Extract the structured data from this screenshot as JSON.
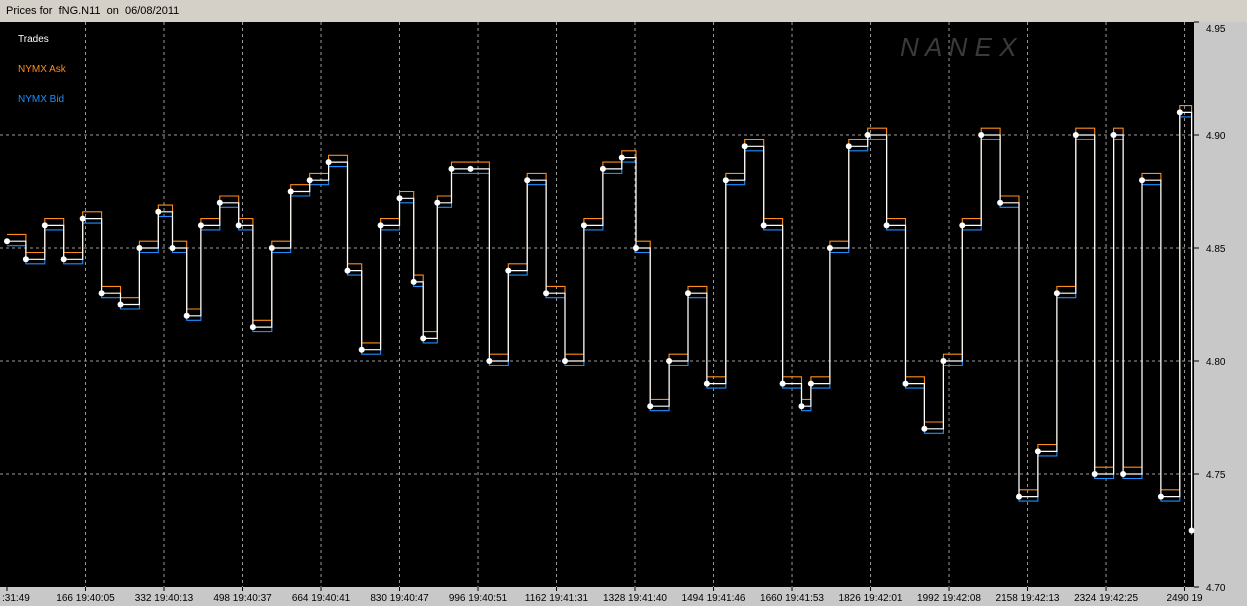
{
  "window": {
    "title": "Prices for  fNG.N11  on  06/08/2011"
  },
  "watermark": "N A N E X",
  "legend": [
    {
      "label": "Trades",
      "color": "#ffffff"
    },
    {
      "label": "NYMX Ask",
      "color": "#ff8c1a"
    },
    {
      "label": "NYMX Bid",
      "color": "#1e8fff"
    }
  ],
  "chart_data": {
    "type": "line",
    "title": "Prices for  fNG.N11  on  06/08/2011",
    "ylim": [
      4.7,
      4.95
    ],
    "yticks": [
      "4.70",
      "4.75",
      "4.80",
      "4.85",
      "4.90",
      "4.95"
    ],
    "grid": true,
    "legend_position": "top-left",
    "xlim": [
      0,
      2510
    ],
    "xticks": [
      {
        "pos": 0,
        "label": ":31:49"
      },
      {
        "pos": 166,
        "label": "166 19:40:05"
      },
      {
        "pos": 332,
        "label": "332 19:40:13"
      },
      {
        "pos": 498,
        "label": "498 19:40:37"
      },
      {
        "pos": 664,
        "label": "664 19:40:41"
      },
      {
        "pos": 830,
        "label": "830 19:40:47"
      },
      {
        "pos": 996,
        "label": "996 19:40:51"
      },
      {
        "pos": 1162,
        "label": "1162 19:41:31"
      },
      {
        "pos": 1328,
        "label": "1328 19:41:40"
      },
      {
        "pos": 1494,
        "label": "1494 19:41:46"
      },
      {
        "pos": 1660,
        "label": "1660 19:41:53"
      },
      {
        "pos": 1826,
        "label": "1826 19:42:01"
      },
      {
        "pos": 1992,
        "label": "1992 19:42:08"
      },
      {
        "pos": 2158,
        "label": "2158 19:42:13"
      },
      {
        "pos": 2324,
        "label": "2324 19:42:25"
      },
      {
        "pos": 2490,
        "label": "2490 19"
      }
    ],
    "series": [
      {
        "name": "Trades",
        "color": "#ffffff",
        "x": [
          0,
          40,
          80,
          120,
          160,
          200,
          240,
          280,
          320,
          350,
          380,
          410,
          450,
          490,
          520,
          560,
          600,
          640,
          680,
          720,
          750,
          790,
          830,
          860,
          880,
          910,
          940,
          980,
          1020,
          1060,
          1100,
          1140,
          1180,
          1220,
          1260,
          1300,
          1330,
          1360,
          1400,
          1440,
          1480,
          1520,
          1560,
          1600,
          1640,
          1680,
          1700,
          1740,
          1780,
          1820,
          1860,
          1900,
          1940,
          1980,
          2020,
          2060,
          2100,
          2140,
          2180,
          2220,
          2260,
          2300,
          2340,
          2360,
          2400,
          2440,
          2480,
          2505
        ],
        "values": [
          4.853,
          4.845,
          4.86,
          4.845,
          4.863,
          4.83,
          4.825,
          4.85,
          4.866,
          4.85,
          4.82,
          4.86,
          4.87,
          4.86,
          4.815,
          4.85,
          4.875,
          4.88,
          4.888,
          4.84,
          4.805,
          4.86,
          4.872,
          4.835,
          4.81,
          4.87,
          4.885,
          4.885,
          4.8,
          4.84,
          4.88,
          4.83,
          4.8,
          4.86,
          4.885,
          4.89,
          4.85,
          4.78,
          4.8,
          4.83,
          4.79,
          4.88,
          4.895,
          4.86,
          4.79,
          4.78,
          4.79,
          4.85,
          4.895,
          4.9,
          4.86,
          4.79,
          4.77,
          4.8,
          4.86,
          4.9,
          4.87,
          4.74,
          4.76,
          4.83,
          4.9,
          4.75,
          4.9,
          4.75,
          4.88,
          4.74,
          4.91,
          4.725
        ]
      },
      {
        "name": "NYMX Ask",
        "color": "#ff8c1a",
        "x": [
          0,
          40,
          80,
          120,
          160,
          200,
          240,
          280,
          320,
          350,
          380,
          410,
          450,
          490,
          520,
          560,
          600,
          640,
          680,
          720,
          750,
          790,
          830,
          860,
          880,
          910,
          940,
          980,
          1020,
          1060,
          1100,
          1140,
          1180,
          1220,
          1260,
          1300,
          1330,
          1360,
          1400,
          1440,
          1480,
          1520,
          1560,
          1600,
          1640,
          1680,
          1700,
          1740,
          1780,
          1820,
          1860,
          1900,
          1940,
          1980,
          2020,
          2060,
          2100,
          2140,
          2180,
          2220,
          2260,
          2300,
          2340,
          2360,
          2400,
          2440,
          2480,
          2505
        ],
        "values": [
          4.856,
          4.848,
          4.863,
          4.848,
          4.866,
          4.833,
          4.828,
          4.853,
          4.869,
          4.853,
          4.823,
          4.863,
          4.873,
          4.863,
          4.818,
          4.853,
          4.878,
          4.883,
          4.891,
          4.843,
          4.808,
          4.863,
          4.875,
          4.838,
          4.813,
          4.873,
          4.888,
          4.888,
          4.803,
          4.843,
          4.883,
          4.833,
          4.803,
          4.863,
          4.888,
          4.893,
          4.853,
          4.783,
          4.803,
          4.833,
          4.793,
          4.883,
          4.898,
          4.863,
          4.793,
          4.783,
          4.793,
          4.853,
          4.898,
          4.903,
          4.863,
          4.793,
          4.773,
          4.803,
          4.863,
          4.903,
          4.873,
          4.743,
          4.763,
          4.833,
          4.903,
          4.753,
          4.903,
          4.753,
          4.883,
          4.743,
          4.913,
          4.728
        ]
      },
      {
        "name": "NYMX Bid",
        "color": "#1e8fff",
        "x": [
          0,
          40,
          80,
          120,
          160,
          200,
          240,
          280,
          320,
          350,
          380,
          410,
          450,
          490,
          520,
          560,
          600,
          640,
          680,
          720,
          750,
          790,
          830,
          860,
          880,
          910,
          940,
          980,
          1020,
          1060,
          1100,
          1140,
          1180,
          1220,
          1260,
          1300,
          1330,
          1360,
          1400,
          1440,
          1480,
          1520,
          1560,
          1600,
          1640,
          1680,
          1700,
          1740,
          1780,
          1820,
          1860,
          1900,
          1940,
          1980,
          2020,
          2060,
          2100,
          2140,
          2180,
          2220,
          2260,
          2300,
          2340,
          2360,
          2400,
          2440,
          2480,
          2505
        ],
        "values": [
          4.851,
          4.843,
          4.858,
          4.843,
          4.861,
          4.828,
          4.823,
          4.848,
          4.864,
          4.848,
          4.818,
          4.858,
          4.868,
          4.858,
          4.813,
          4.848,
          4.873,
          4.878,
          4.886,
          4.838,
          4.803,
          4.858,
          4.87,
          4.833,
          4.808,
          4.868,
          4.883,
          4.883,
          4.798,
          4.838,
          4.878,
          4.828,
          4.798,
          4.858,
          4.883,
          4.888,
          4.848,
          4.778,
          4.798,
          4.828,
          4.788,
          4.878,
          4.893,
          4.858,
          4.788,
          4.778,
          4.788,
          4.848,
          4.893,
          4.898,
          4.858,
          4.788,
          4.768,
          4.798,
          4.858,
          4.898,
          4.868,
          4.738,
          4.758,
          4.828,
          4.898,
          4.748,
          4.898,
          4.748,
          4.878,
          4.738,
          4.908,
          4.723
        ]
      }
    ]
  }
}
